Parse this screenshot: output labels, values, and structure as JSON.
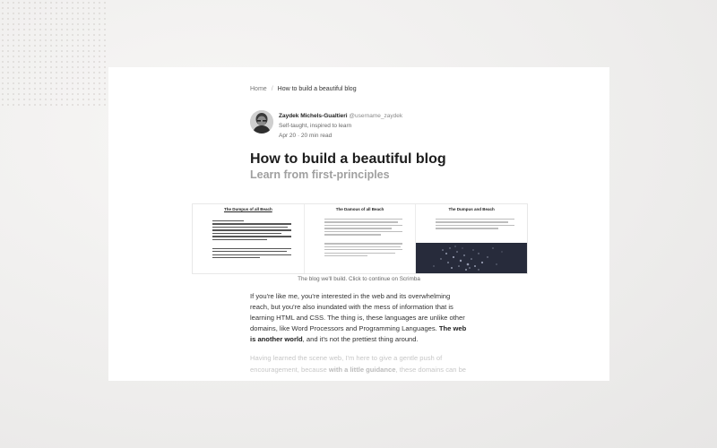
{
  "breadcrumb": {
    "home": "Home",
    "separator": "/",
    "current": "How to build a beautiful blog"
  },
  "author": {
    "name": "Zaydek Michels-Gualtieri",
    "handle": "@username_zaydek",
    "bio": "Self-taught, inspired to learn",
    "meta": "Apr 20 · 20 min read"
  },
  "article": {
    "title": "How to build a beautiful blog",
    "subtitle": "Learn from first-principles"
  },
  "figure": {
    "panels": [
      {
        "title": "The Dumpus of all Beach"
      },
      {
        "title": "The Damous of all Beach"
      },
      {
        "title": "The Dumpus and Beach"
      }
    ],
    "caption": "The blog we'll build. Click to continue on Scrimba"
  },
  "body": {
    "p1_a": "If you're like me, you're interested in the web and its overwhelming reach, but you're also inundated with the mess of information that is learning HTML and CSS. The thing is, these languages are unlike other domains, like Word Processors and Programming Languages. ",
    "p1_b": "The web is another world",
    "p1_c": ", and it's not the prettiest thing around.",
    "p2_a": "Having learned the scene web, I'm here to give a gentle push of encouragement, because ",
    "p2_b": "with a little guidance",
    "p2_c": ", these domains can be"
  },
  "colors": {
    "background": "#eeedec",
    "card": "#ffffff",
    "title": "#1d1d1d",
    "subtitle": "#a0a0a0",
    "dark_panel": "#272b3b"
  }
}
